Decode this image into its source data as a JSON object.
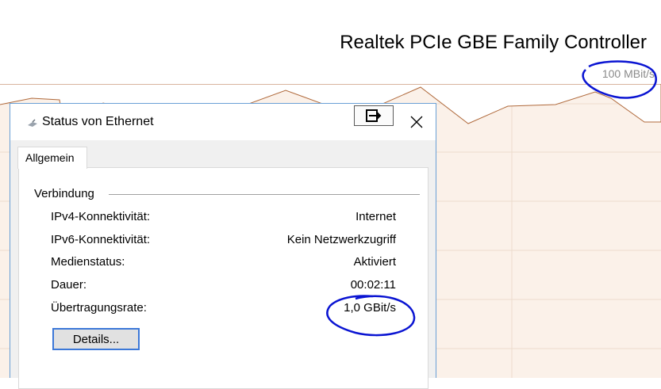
{
  "taskmanager": {
    "adapter_title": "Realtek PCIe GBE Family Controller",
    "graph_max_label": "100 MBit/s",
    "graph_color": "#a0522d",
    "graph_fill": "#fbf1e9"
  },
  "dialog": {
    "title": "Status von Ethernet",
    "tab_label": "Allgemein",
    "group_label": "Verbindung",
    "rows": [
      {
        "label": "IPv4-Konnektivität:",
        "value": "Internet"
      },
      {
        "label": "IPv6-Konnektivität:",
        "value": "Kein Netzwerkzugriff"
      },
      {
        "label": "Medienstatus:",
        "value": "Aktiviert"
      },
      {
        "label": "Dauer:",
        "value": "00:02:11"
      },
      {
        "label": "Übertragungsrate:",
        "value": "1,0 GBit/s"
      }
    ],
    "details_button": "Details..."
  },
  "annotation_color": "#0a14d2"
}
